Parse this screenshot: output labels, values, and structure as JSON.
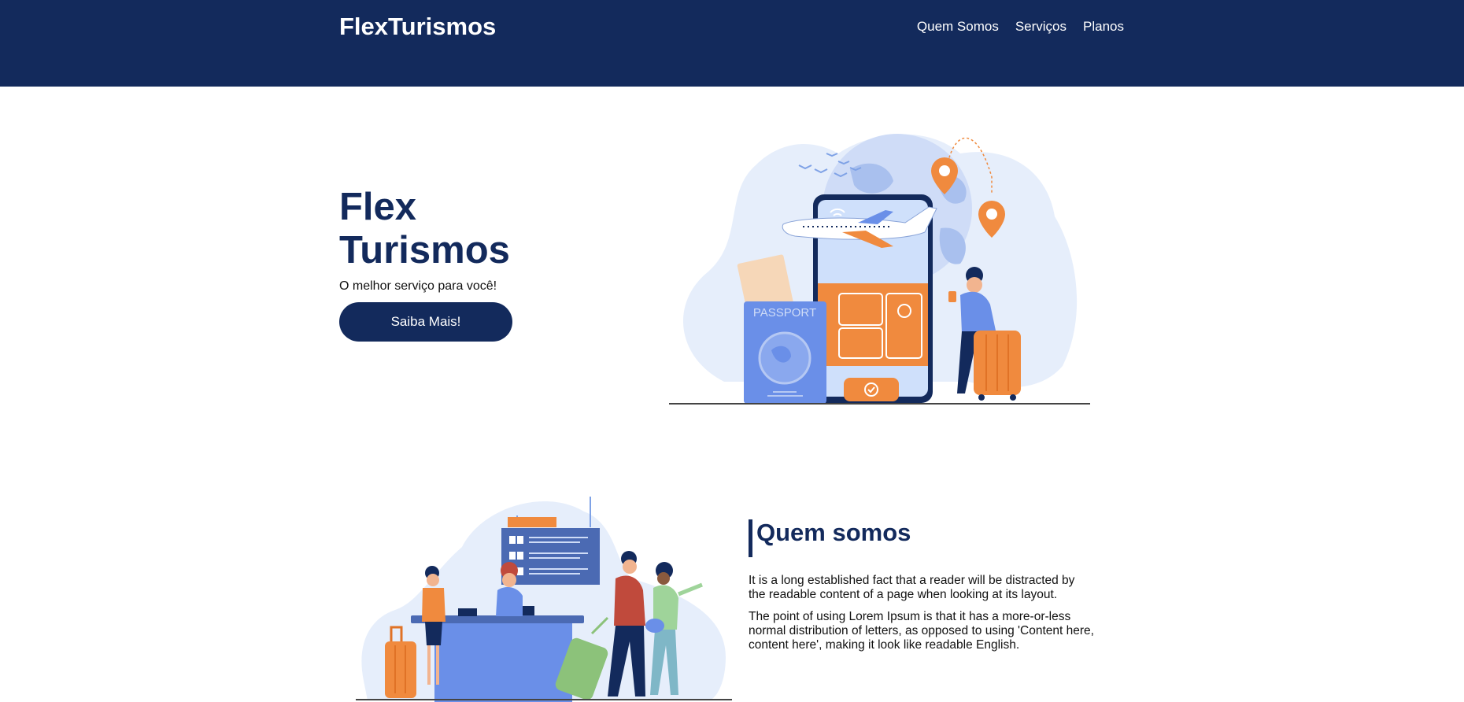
{
  "header": {
    "brand": "FlexTurismos",
    "nav": [
      "Quem Somos",
      "Serviços",
      "Planos"
    ]
  },
  "hero": {
    "title_line1": "Flex",
    "title_line2": "Turismos",
    "subtitle": "O melhor serviço para você!",
    "cta_label": "Saiba Mais!",
    "illustration_text": "PASSPORT"
  },
  "about": {
    "title": "Quem somos",
    "paragraphs": [
      "It is a long established fact that a reader will be distracted by the readable content of a page when looking at its layout.",
      "The point of using Lorem Ipsum is that it has a more-or-less normal distribution of letters, as opposed to using 'Content here, content here', making it look like readable English."
    ]
  },
  "colors": {
    "primary": "#132a5c",
    "accent_orange": "#f08a3e",
    "accent_blue": "#6a8fe8",
    "light_blue": "#e6eefb"
  },
  "icons": [
    "airplane-icon",
    "location-pin-icon",
    "passport-icon",
    "suitcase-icon",
    "check-icon",
    "wifi-icon"
  ]
}
